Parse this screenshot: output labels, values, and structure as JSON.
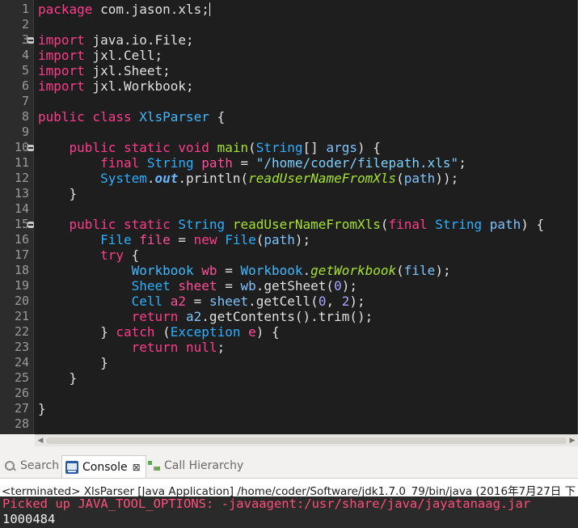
{
  "editor": {
    "lines": [
      {
        "n": "1",
        "tokens": [
          [
            "kw",
            "package"
          ],
          [
            "pl",
            " com.jason.xls;"
          ]
        ],
        "caret": true
      },
      {
        "n": "2",
        "tokens": []
      },
      {
        "n": "3",
        "fold": true,
        "tokens": [
          [
            "kw",
            "import"
          ],
          [
            "pl",
            " java.io.File;"
          ]
        ]
      },
      {
        "n": "4",
        "tokens": [
          [
            "kw",
            "import"
          ],
          [
            "pl",
            " jxl.Cell;"
          ]
        ]
      },
      {
        "n": "5",
        "tokens": [
          [
            "kw",
            "import"
          ],
          [
            "pl",
            " jxl.Sheet;"
          ]
        ]
      },
      {
        "n": "6",
        "tokens": [
          [
            "kw",
            "import"
          ],
          [
            "pl",
            " jxl.Workbook;"
          ]
        ]
      },
      {
        "n": "7",
        "tokens": []
      },
      {
        "n": "8",
        "tokens": [
          [
            "kw",
            "public class "
          ],
          [
            "cl",
            "XlsParser"
          ],
          [
            "pl",
            " {"
          ]
        ]
      },
      {
        "n": "9",
        "tokens": []
      },
      {
        "n": "10",
        "fold": true,
        "tokens": [
          [
            "pl",
            "    "
          ],
          [
            "kw",
            "public static void "
          ],
          [
            "me",
            "main"
          ],
          [
            "pl",
            "("
          ],
          [
            "ty",
            "String"
          ],
          [
            "pl",
            "[] "
          ],
          [
            "pr",
            "args"
          ],
          [
            "pl",
            ") {"
          ]
        ]
      },
      {
        "n": "11",
        "tokens": [
          [
            "pl",
            "        "
          ],
          [
            "kw",
            "final "
          ],
          [
            "ty",
            "String "
          ],
          [
            "va",
            "path"
          ],
          [
            "pl",
            " = "
          ],
          [
            "st",
            "\"/home/coder/filepath.xls\""
          ],
          [
            "pl",
            ";"
          ]
        ]
      },
      {
        "n": "12",
        "tokens": [
          [
            "pl",
            "        "
          ],
          [
            "ty",
            "System"
          ],
          [
            "pl",
            "."
          ],
          [
            "fi",
            "out"
          ],
          [
            "pl",
            "."
          ],
          [
            "pl",
            "println("
          ],
          [
            "it",
            "readUserNameFromXls"
          ],
          [
            "pl",
            "("
          ],
          [
            "pr",
            "path"
          ],
          [
            "pl",
            "));"
          ]
        ]
      },
      {
        "n": "13",
        "tokens": [
          [
            "pl",
            "    }"
          ]
        ]
      },
      {
        "n": "14",
        "tokens": []
      },
      {
        "n": "15",
        "fold": true,
        "tokens": [
          [
            "pl",
            "    "
          ],
          [
            "kw",
            "public static "
          ],
          [
            "ty",
            "String "
          ],
          [
            "me",
            "readUserNameFromXls"
          ],
          [
            "pl",
            "("
          ],
          [
            "kw",
            "final "
          ],
          [
            "ty",
            "String "
          ],
          [
            "pr",
            "path"
          ],
          [
            "pl",
            ") {"
          ]
        ]
      },
      {
        "n": "16",
        "tokens": [
          [
            "pl",
            "        "
          ],
          [
            "ty",
            "File "
          ],
          [
            "va",
            "file"
          ],
          [
            "pl",
            " = "
          ],
          [
            "kw",
            "new "
          ],
          [
            "ty",
            "File"
          ],
          [
            "pl",
            "("
          ],
          [
            "pr",
            "path"
          ],
          [
            "pl",
            ");"
          ]
        ]
      },
      {
        "n": "17",
        "tokens": [
          [
            "pl",
            "        "
          ],
          [
            "kw",
            "try"
          ],
          [
            "pl",
            " {"
          ]
        ]
      },
      {
        "n": "18",
        "tokens": [
          [
            "pl",
            "            "
          ],
          [
            "cl",
            "Workbook "
          ],
          [
            "va",
            "wb"
          ],
          [
            "pl",
            " = "
          ],
          [
            "cl",
            "Workbook"
          ],
          [
            "pl",
            "."
          ],
          [
            "it",
            "getWorkbook"
          ],
          [
            "pl",
            "("
          ],
          [
            "pr",
            "file"
          ],
          [
            "pl",
            ");"
          ]
        ]
      },
      {
        "n": "19",
        "tokens": [
          [
            "pl",
            "            "
          ],
          [
            "ty",
            "Sheet "
          ],
          [
            "va",
            "sheet"
          ],
          [
            "pl",
            " = "
          ],
          [
            "pr",
            "wb"
          ],
          [
            "pl",
            ".getSheet("
          ],
          [
            "nu",
            "0"
          ],
          [
            "pl",
            ");"
          ]
        ]
      },
      {
        "n": "20",
        "tokens": [
          [
            "pl",
            "            "
          ],
          [
            "ty",
            "Cell "
          ],
          [
            "va",
            "a2"
          ],
          [
            "pl",
            " = "
          ],
          [
            "pr",
            "sheet"
          ],
          [
            "pl",
            ".getCell("
          ],
          [
            "nu",
            "0"
          ],
          [
            "pl",
            ", "
          ],
          [
            "nu",
            "2"
          ],
          [
            "pl",
            ");"
          ]
        ]
      },
      {
        "n": "21",
        "tokens": [
          [
            "pl",
            "            "
          ],
          [
            "kw",
            "return "
          ],
          [
            "pr",
            "a2"
          ],
          [
            "pl",
            ".getContents().trim();"
          ]
        ]
      },
      {
        "n": "22",
        "tokens": [
          [
            "pl",
            "        } "
          ],
          [
            "kw",
            "catch"
          ],
          [
            "pl",
            " ("
          ],
          [
            "ty",
            "Exception "
          ],
          [
            "va",
            "e"
          ],
          [
            "pl",
            ") {"
          ]
        ]
      },
      {
        "n": "23",
        "tokens": [
          [
            "pl",
            "            "
          ],
          [
            "kw",
            "return null"
          ],
          [
            "pl",
            ";"
          ]
        ]
      },
      {
        "n": "24",
        "tokens": [
          [
            "pl",
            "        }"
          ]
        ]
      },
      {
        "n": "25",
        "tokens": [
          [
            "pl",
            "    }"
          ]
        ]
      },
      {
        "n": "26",
        "tokens": []
      },
      {
        "n": "27",
        "tokens": [
          [
            "pl",
            "}"
          ]
        ]
      },
      {
        "n": "28",
        "tokens": []
      }
    ]
  },
  "tabs": {
    "search": "Search",
    "console": "Console",
    "console_close": "⊠",
    "hierarchy": "Call Hierarchy"
  },
  "console": {
    "status": "<terminated> XlsParser [Java Application] /home/coder/Software/jdk1.7.0_79/bin/java (2016年7月27日 下",
    "stderr": "Picked up JAVA_TOOL_OPTIONS: -javaagent:/usr/share/java/jayatanaag.jar",
    "stdout": "1000484"
  },
  "colors": {
    "editor_bg": "#1e1e1e",
    "keyword": "#ff3c8c",
    "type": "#2ab0ff",
    "error_text": "#ff4f7a"
  }
}
